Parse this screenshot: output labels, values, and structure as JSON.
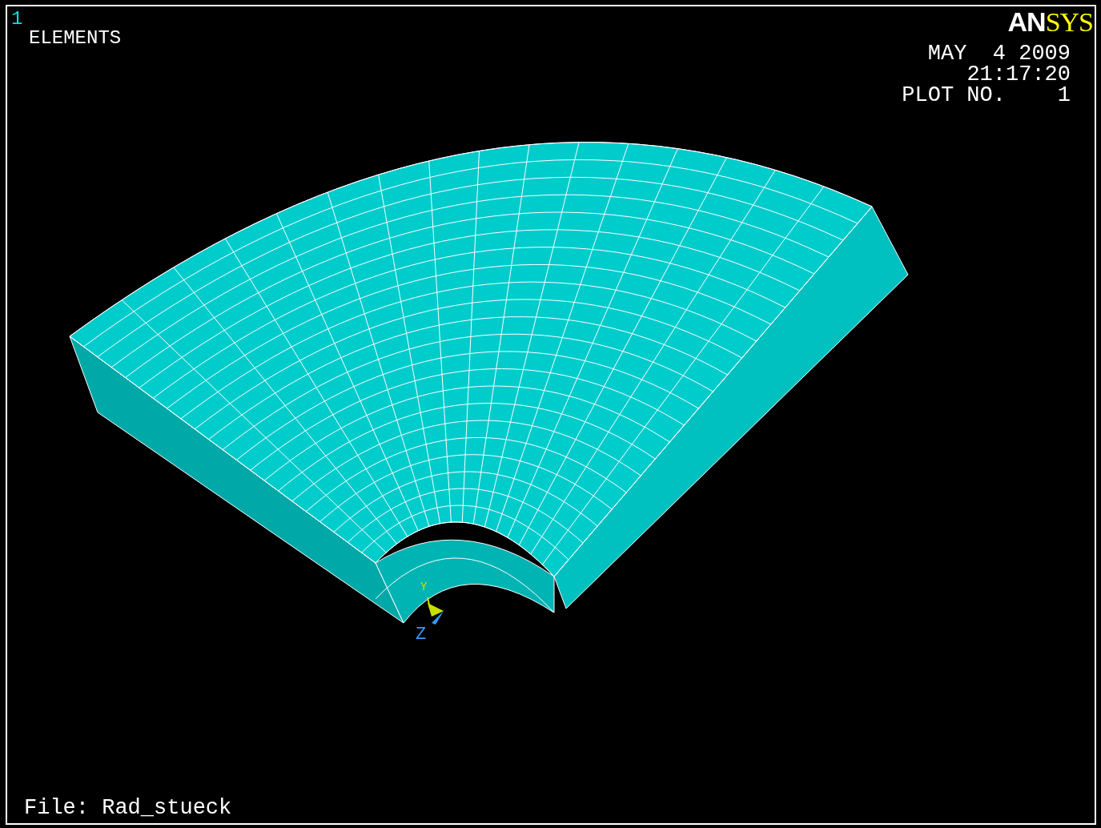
{
  "window_number": "1",
  "plot_title": "ELEMENTS",
  "logo": {
    "primary": "AN",
    "secondary": "SYS"
  },
  "date": "MAY  4 2009",
  "time": "21:17:20",
  "plot_number": "PLOT NO.    1",
  "triad": {
    "y_label": "Y",
    "z_label": "Z"
  },
  "file_label": "File: Rad_stueck"
}
